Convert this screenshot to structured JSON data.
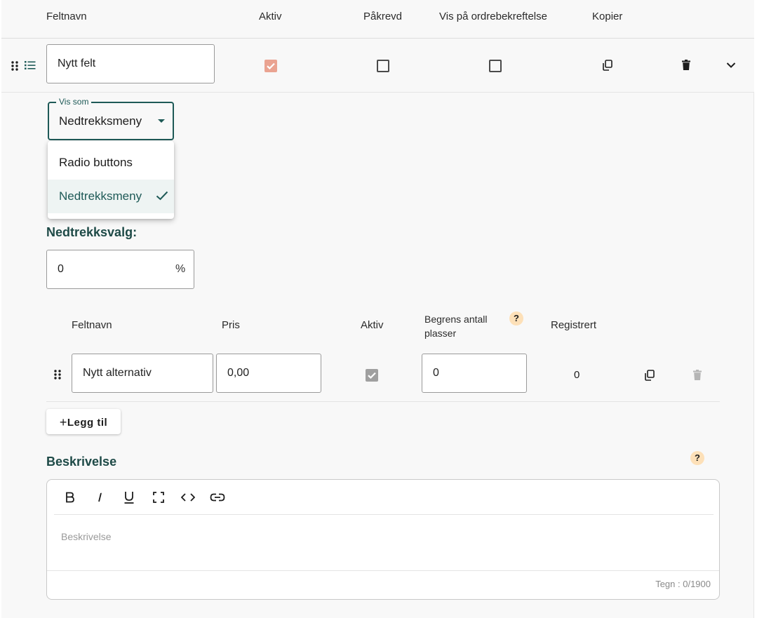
{
  "header": {
    "columns": [
      "Feltnavn",
      "Aktiv",
      "Påkrevd",
      "Vis på ordrebekreftelse",
      "Kopier"
    ]
  },
  "field": {
    "name_value": "Nytt felt",
    "aktiv": true,
    "pakrevd": false,
    "vis_pa_ordre": false
  },
  "display_as": {
    "legend": "Vis som",
    "value": "Nedtrekksmeny",
    "options": [
      "Radio buttons",
      "Nedtrekksmeny"
    ],
    "selected_index": 1
  },
  "dropdown_choices": {
    "title": "Nedtrekksvalg:",
    "percent_value": "0",
    "percent_unit": "%"
  },
  "options_table": {
    "headers": {
      "name": "Feltnavn",
      "price": "Pris",
      "active": "Aktiv",
      "limit": "Begrens antall plasser",
      "registered": "Registrert"
    },
    "help_symbol": "?",
    "rows": [
      {
        "name": "Nytt alternativ",
        "price": "0,00",
        "active": true,
        "limit": "0",
        "registered": "0"
      }
    ],
    "add_label": "Legg til"
  },
  "description": {
    "title": "Beskrivelse",
    "help_symbol": "?",
    "placeholder": "Beskrivelse",
    "counter": "Tegn : 0/1900",
    "toolbar": [
      "bold-icon",
      "italic-icon",
      "underline-icon",
      "fullscreen-icon",
      "code-icon",
      "link-icon"
    ]
  },
  "colors": {
    "accent": "#1e5a57",
    "checkbox_active": "#eaa391",
    "checkbox_grey": "#a0a0a0",
    "help_badge": "#fde0b8"
  }
}
